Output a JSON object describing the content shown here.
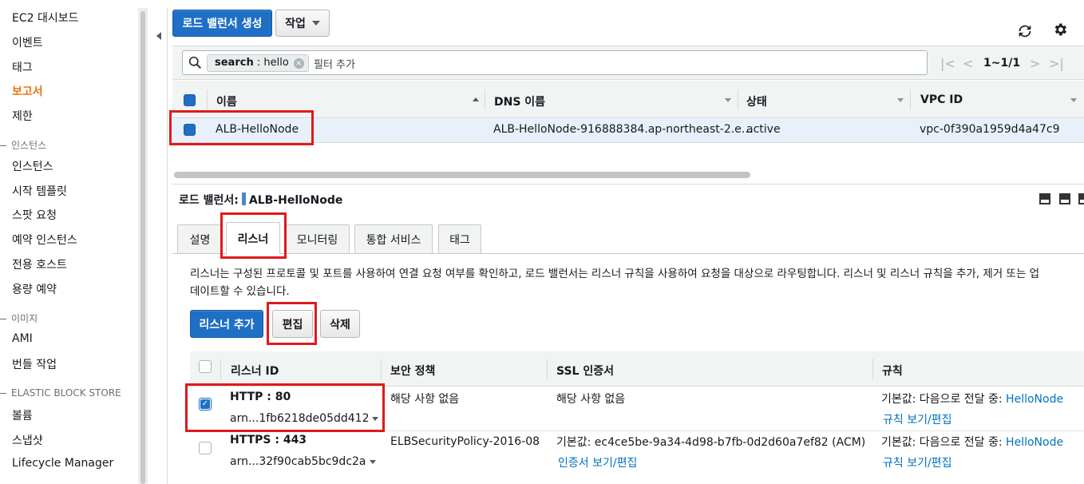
{
  "sidebar": {
    "items": [
      {
        "label": "EC2 대시보드"
      },
      {
        "label": "이벤트"
      },
      {
        "label": "태그"
      },
      {
        "label": "보고서"
      },
      {
        "label": "제한"
      }
    ],
    "section_instances": "인스턴스",
    "instances_items": [
      {
        "label": "인스턴스"
      },
      {
        "label": "시작 템플릿"
      },
      {
        "label": "스팟 요청"
      },
      {
        "label": "예약 인스턴스"
      },
      {
        "label": "전용 호스트"
      },
      {
        "label": "용량 예약"
      }
    ],
    "section_images": "이미지",
    "images_items": [
      {
        "label": "AMI"
      },
      {
        "label": "번들 작업"
      }
    ],
    "section_ebs": "ELASTIC BLOCK STORE",
    "ebs_items": [
      {
        "label": "볼륨"
      },
      {
        "label": "스냅샷"
      },
      {
        "label": "Lifecycle Manager"
      }
    ]
  },
  "toolbar": {
    "create_lb_label": "로드 밸런서 생성",
    "actions_label": "작업"
  },
  "search": {
    "token_key": "search",
    "token_sep": " : ",
    "token_value": "hello",
    "placeholder": "필터 추가"
  },
  "pagination": {
    "text": "1~1/1"
  },
  "lb_table": {
    "columns": [
      "이름",
      "DNS 이름",
      "상태",
      "VPC ID"
    ],
    "rows": [
      {
        "name": "ALB-HelloNode",
        "dns": "ALB-HelloNode-916888384.ap-northeast-2.e…",
        "state": "active",
        "vpc": "vpc-0f390a1959d4a47c9"
      }
    ]
  },
  "detail": {
    "title_label": "로드 밸런서:",
    "title_value": "ALB-HelloNode",
    "tabs": [
      {
        "label": "설명"
      },
      {
        "label": "리스너"
      },
      {
        "label": "모니터링"
      },
      {
        "label": "통합 서비스"
      },
      {
        "label": "태그"
      }
    ],
    "description_line1": "리스너는 구성된 프로토콜 및 포트를 사용하여 연결 요청 여부를 확인하고, 로드 밸런서는 리스너 규칙을 사용하여 요청을 대상으로 라우팅합니다. 리스너 및 리스너 규칙을 추가, 제거 또는 업",
    "description_line2": "데이트할 수 있습니다.",
    "add_listener_label": "리스너 추가",
    "edit_label": "편집",
    "delete_label": "삭제"
  },
  "listener_table": {
    "columns": [
      "리스너 ID",
      "보안 정책",
      "SSL 인증서",
      "규칙"
    ],
    "rows": [
      {
        "protocol": "HTTP : 80",
        "arn": "arn...1fb6218de05dd412",
        "policy": "해당 사항 없음",
        "cert": "해당 사항 없음",
        "cert_link": "",
        "rule_prefix": "기본값:  다음으로 전달 중: ",
        "rule_target": "HelloNode",
        "rule_link": "규칙 보기/편집",
        "checked": true
      },
      {
        "protocol": "HTTPS : 443",
        "arn": "arn...32f90cab5bc9dc2a",
        "policy": "ELBSecurityPolicy-2016-08",
        "cert": "기본값:  ec4ce5be-9a34-4d98-b7fb-0d2d60a7ef82 (ACM)",
        "cert_link": "인증서 보기/편집",
        "rule_prefix": "기본값:  다음으로 전달 중: ",
        "rule_target": "HelloNode",
        "rule_link": "규칙 보기/편집",
        "checked": false
      }
    ]
  },
  "colors": {
    "primary": "#1f6fc5",
    "active_nav": "#ec7211",
    "link": "#0073bb",
    "highlight": "#e0191b"
  }
}
